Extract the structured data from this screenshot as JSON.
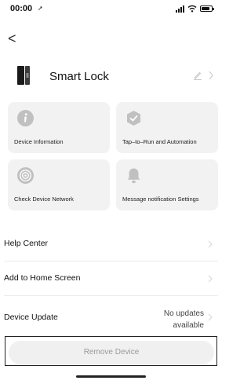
{
  "status_bar": {
    "time": "00:00",
    "icons": [
      "location-arrow-icon",
      "cellular-signal-icon",
      "wifi-icon",
      "battery-icon"
    ],
    "battery_level": 0.8
  },
  "nav": {
    "back_label": "<"
  },
  "device": {
    "name": "Smart Lock",
    "icon": "smart-lock-icon"
  },
  "cards": [
    {
      "label": "Device Information",
      "icon": "info-icon"
    },
    {
      "label": "Tap–to–Run and Automation",
      "icon": "automation-check-icon"
    },
    {
      "label": "Check Device Network",
      "icon": "network-signal-icon"
    },
    {
      "label": "Message notification Settings",
      "icon": "bell-icon"
    }
  ],
  "list": {
    "help_center": "Help Center",
    "add_to_home": "Add to Home Screen",
    "device_update": "Device Update",
    "update_status_line1": "No updates",
    "update_status_line2": "available"
  },
  "remove_device": "Remove Device",
  "colors": {
    "card_background": "#f2f2f2",
    "icon_gray": "#bdbdbd",
    "remove_text": "#999999",
    "divider": "#ececec"
  }
}
